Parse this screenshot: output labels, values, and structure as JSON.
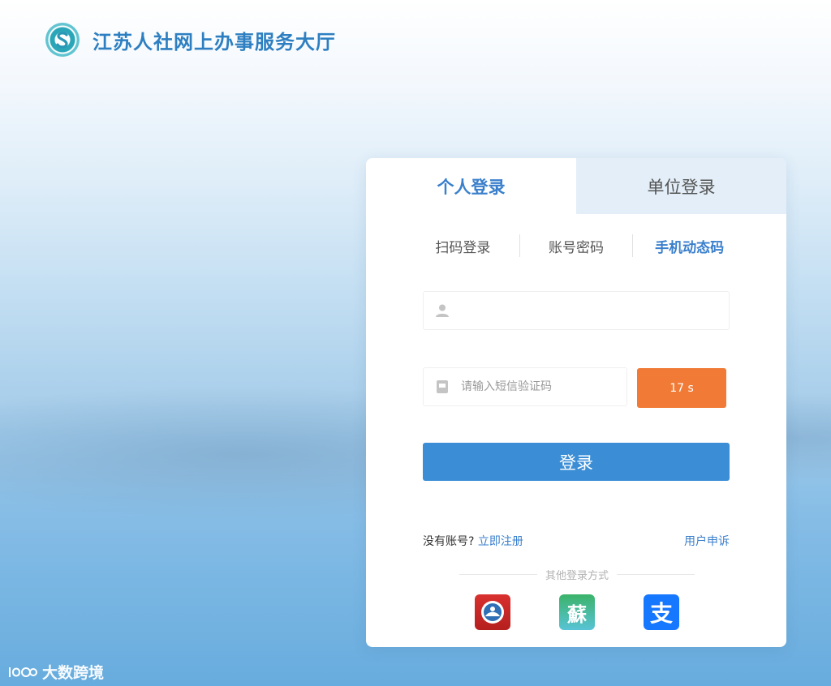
{
  "header": {
    "title": "江苏人社网上办事服务大厅"
  },
  "card": {
    "top_tabs": [
      {
        "label": "个人登录",
        "active": true
      },
      {
        "label": "单位登录",
        "active": false
      }
    ],
    "sub_tabs": [
      {
        "label": "扫码登录",
        "active": false
      },
      {
        "label": "账号密码",
        "active": false
      },
      {
        "label": "手机动态码",
        "active": true
      }
    ],
    "phone_input": {
      "value": "",
      "icon": "user-icon"
    },
    "code_input": {
      "value": "",
      "placeholder": "请输入短信验证码",
      "icon": "message-icon"
    },
    "timer_button": {
      "label": "17 s",
      "color": "#f07a36"
    },
    "login_button": {
      "label": "登录",
      "color": "#3b8ed6"
    },
    "no_account_text": "没有账号?",
    "register_link": "立即注册",
    "complaint_link": "用户申诉",
    "other_login_label": "其他登录方式",
    "other_login_icons": [
      "app-icon",
      "su-icon",
      "alipay-icon"
    ],
    "su_glyph": "蘇",
    "alipay_glyph": "支"
  },
  "watermark": {
    "text": "大数跨境"
  },
  "colors": {
    "accent": "#3a7fcc",
    "orange": "#f07a36"
  }
}
